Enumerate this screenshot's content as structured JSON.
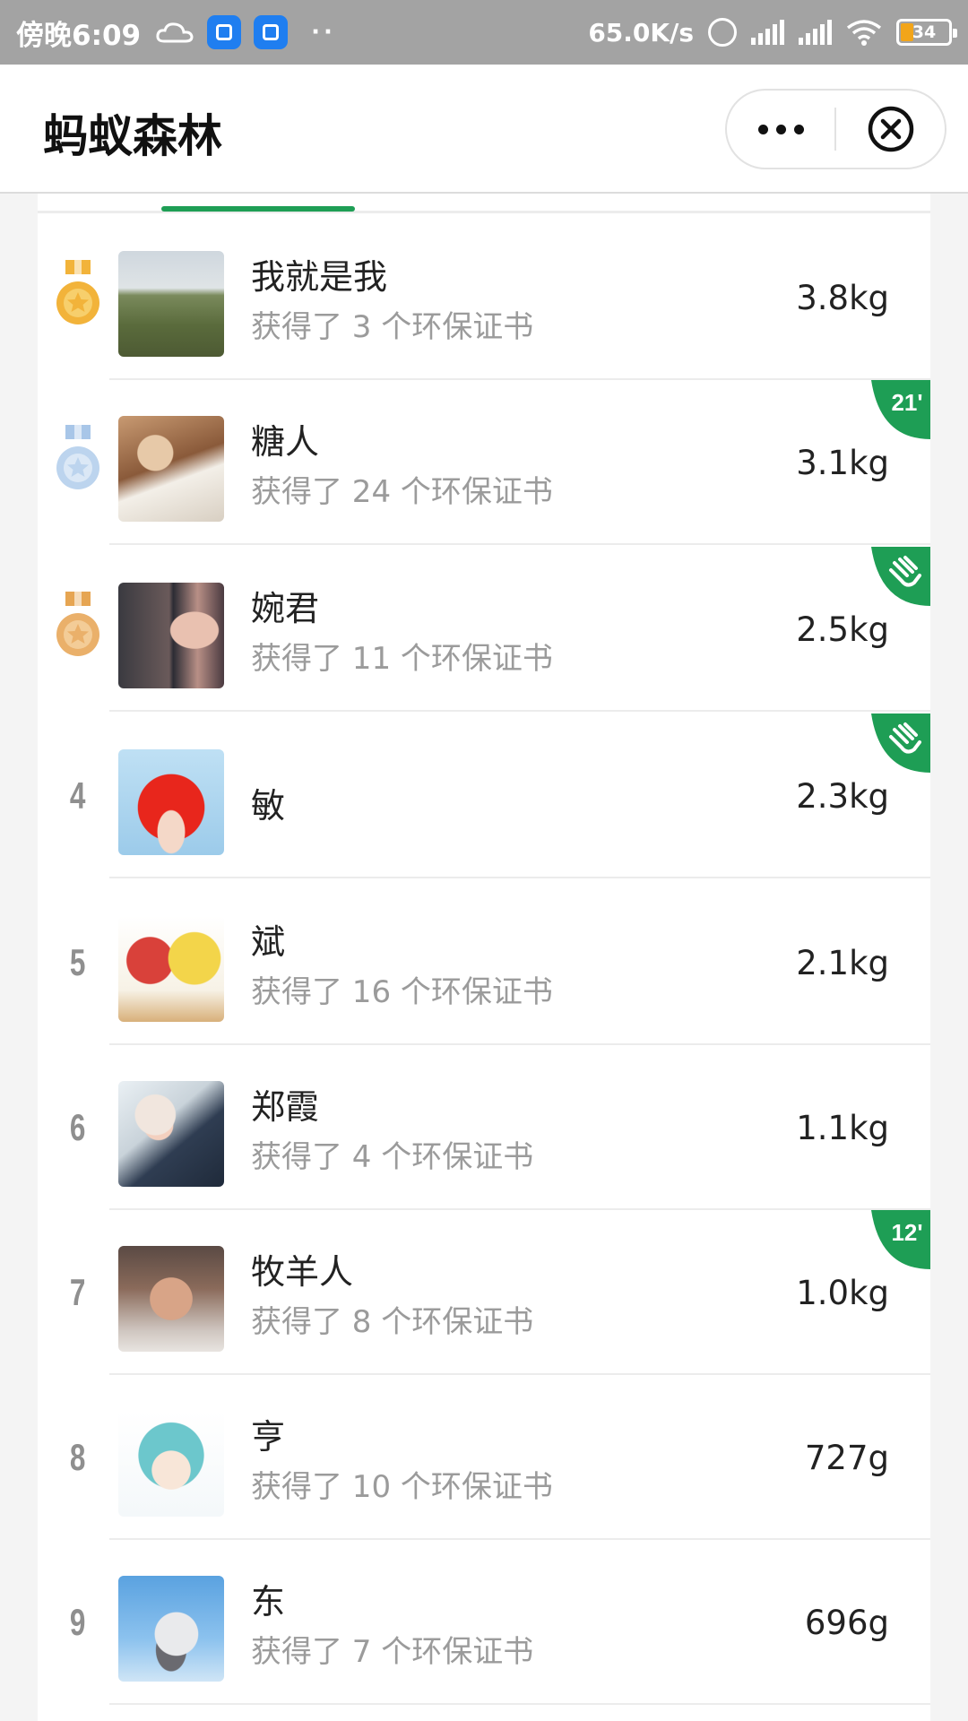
{
  "status_bar": {
    "time": "傍晚6:09",
    "network_speed": "65.0K/s",
    "battery": "34"
  },
  "navbar": {
    "title": "蚂蚁森林"
  },
  "colors": {
    "accent_green": "#1e9e55",
    "gold_medal": "#f2b33a",
    "silver_medal": "#a8c6e8",
    "bronze_medal": "#e6a552"
  },
  "ranking": [
    {
      "rank": 1,
      "medal": "gold",
      "name": "我就是我",
      "certs": "获得了 3 个环保证书",
      "weight": "3.8kg"
    },
    {
      "rank": 2,
      "medal": "silver",
      "name": "糖人",
      "certs": "获得了 24 个环保证书",
      "weight": "3.1kg",
      "badge": "21'"
    },
    {
      "rank": 3,
      "medal": "bronze",
      "name": "婉君",
      "certs": "获得了 11 个环保证书",
      "weight": "2.5kg",
      "badge_icon": "hand-icon"
    },
    {
      "rank": "4",
      "name": "敏",
      "certs": "",
      "weight": "2.3kg",
      "badge_icon": "hand-icon"
    },
    {
      "rank": "5",
      "name": "斌",
      "certs": "获得了 16 个环保证书",
      "weight": "2.1kg"
    },
    {
      "rank": "6",
      "name": "郑霞",
      "certs": "获得了 4 个环保证书",
      "weight": "1.1kg"
    },
    {
      "rank": "7",
      "name": "牧羊人",
      "certs": "获得了 8 个环保证书",
      "weight": "1.0kg",
      "badge": "12'"
    },
    {
      "rank": "8",
      "name": "亨",
      "certs": "获得了 10 个环保证书",
      "weight": "727g"
    },
    {
      "rank": "9",
      "name": "东",
      "certs": "获得了 7 个环保证书",
      "weight": "696g"
    }
  ]
}
